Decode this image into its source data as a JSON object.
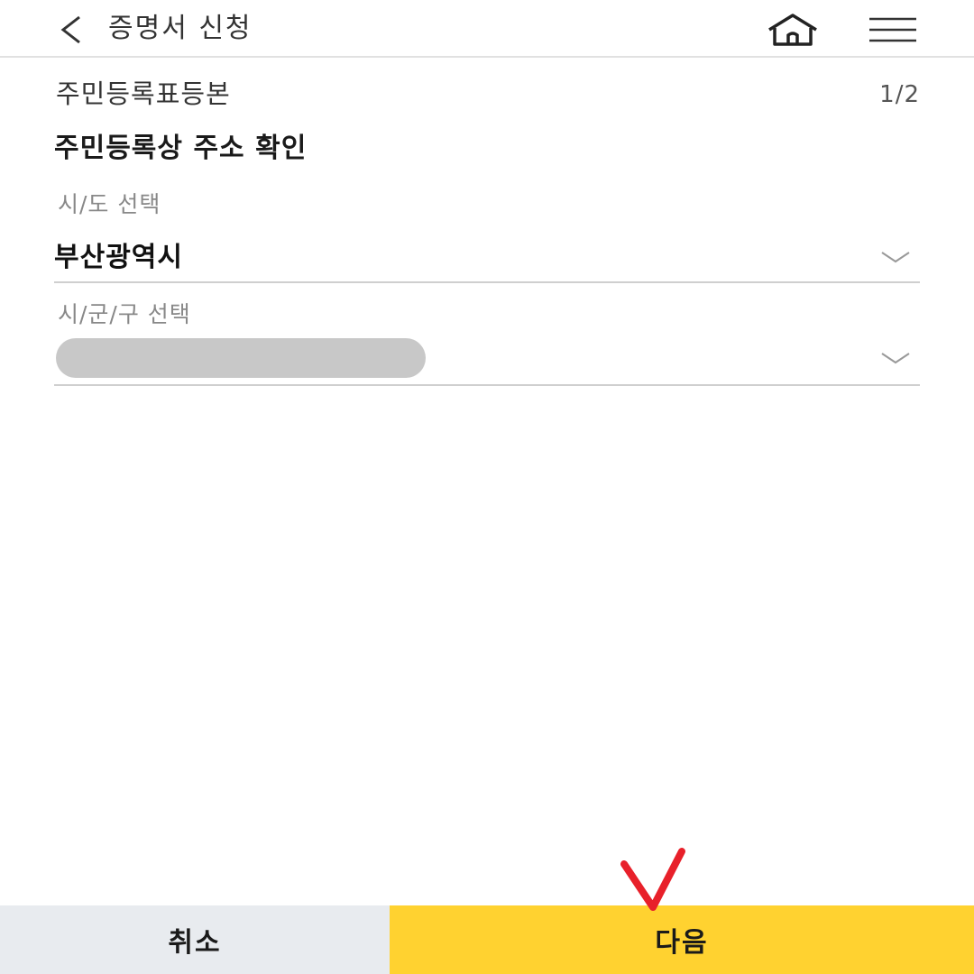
{
  "header": {
    "title": "증명서 신청",
    "back_icon": "chevron-left-icon",
    "home_icon": "home-icon",
    "menu_icon": "hamburger-menu-icon"
  },
  "document": {
    "name": "주민등록표등본",
    "step": "1/2"
  },
  "section": {
    "title": "주민등록상 주소 확인"
  },
  "fields": {
    "province": {
      "label": "시/도 선택",
      "value": "부산광역시"
    },
    "district": {
      "label": "시/군/구 선택",
      "value": ""
    }
  },
  "footer": {
    "cancel_label": "취소",
    "next_label": "다음"
  },
  "colors": {
    "accent": "#ffd230",
    "cancel_bg": "#e8ebef",
    "annotation": "#e8202a"
  }
}
